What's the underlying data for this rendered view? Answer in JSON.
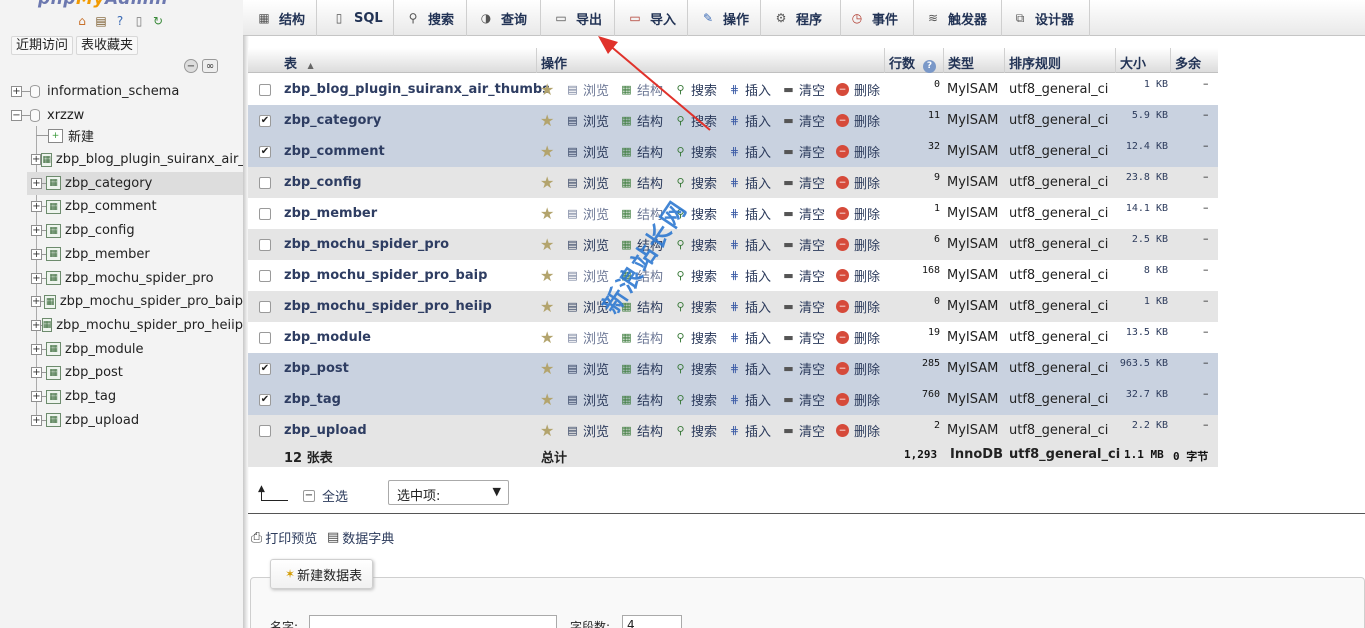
{
  "nav": {
    "logo_parts": [
      "php",
      "My",
      "Admin"
    ],
    "recent_btn": "近期访问",
    "favorites_btn": "表收藏夹",
    "databases": [
      {
        "name": "information_schema",
        "expanded": false
      },
      {
        "name": "xrzzw",
        "expanded": true
      }
    ],
    "new_label": "新建",
    "tables": [
      "zbp_blog_plugin_suiranx_air_",
      "zbp_category",
      "zbp_comment",
      "zbp_config",
      "zbp_member",
      "zbp_mochu_spider_pro",
      "zbp_mochu_spider_pro_baip",
      "zbp_mochu_spider_pro_heiip",
      "zbp_module",
      "zbp_post",
      "zbp_tag",
      "zbp_upload"
    ],
    "selected_table": "zbp_category"
  },
  "menu": {
    "tabs": [
      {
        "label": "结构",
        "icon": "structure-icon"
      },
      {
        "label": "SQL",
        "icon": "sql-icon"
      },
      {
        "label": "搜索",
        "icon": "search-icon"
      },
      {
        "label": "查询",
        "icon": "query-icon"
      },
      {
        "label": "导出",
        "icon": "export-icon"
      },
      {
        "label": "导入",
        "icon": "import-icon"
      },
      {
        "label": "操作",
        "icon": "wrench-icon"
      },
      {
        "label": "程序",
        "icon": "routines-icon"
      },
      {
        "label": "事件",
        "icon": "clock-icon"
      },
      {
        "label": "触发器",
        "icon": "trigger-icon"
      },
      {
        "label": "设计器",
        "icon": "designer-icon"
      }
    ]
  },
  "table": {
    "headers": {
      "table": "表",
      "sort_indicator": "▲",
      "action": "操作",
      "rows": "行数",
      "type": "类型",
      "collation": "排序规则",
      "size": "大小",
      "overhead": "多余"
    },
    "actions": {
      "browse": "浏览",
      "structure": "结构",
      "search": "搜索",
      "insert": "插入",
      "empty": "清空",
      "drop": "删除"
    },
    "rows": [
      {
        "name": "zbp_blog_plugin_suiranx_air_thumbs",
        "rows": "0",
        "type": "MyISAM",
        "collation": "utf8_general_ci",
        "size": "1 KB",
        "overhead": "–",
        "checked": false
      },
      {
        "name": "zbp_category",
        "rows": "11",
        "type": "MyISAM",
        "collation": "utf8_general_ci",
        "size": "5.9 KB",
        "overhead": "–",
        "checked": true
      },
      {
        "name": "zbp_comment",
        "rows": "32",
        "type": "MyISAM",
        "collation": "utf8_general_ci",
        "size": "12.4 KB",
        "overhead": "–",
        "checked": true
      },
      {
        "name": "zbp_config",
        "rows": "9",
        "type": "MyISAM",
        "collation": "utf8_general_ci",
        "size": "23.8 KB",
        "overhead": "–",
        "checked": false
      },
      {
        "name": "zbp_member",
        "rows": "1",
        "type": "MyISAM",
        "collation": "utf8_general_ci",
        "size": "14.1 KB",
        "overhead": "–",
        "checked": false
      },
      {
        "name": "zbp_mochu_spider_pro",
        "rows": "6",
        "type": "MyISAM",
        "collation": "utf8_general_ci",
        "size": "2.5 KB",
        "overhead": "–",
        "checked": false
      },
      {
        "name": "zbp_mochu_spider_pro_baip",
        "rows": "168",
        "type": "MyISAM",
        "collation": "utf8_general_ci",
        "size": "8 KB",
        "overhead": "–",
        "checked": false
      },
      {
        "name": "zbp_mochu_spider_pro_heiip",
        "rows": "0",
        "type": "MyISAM",
        "collation": "utf8_general_ci",
        "size": "1 KB",
        "overhead": "–",
        "checked": false
      },
      {
        "name": "zbp_module",
        "rows": "19",
        "type": "MyISAM",
        "collation": "utf8_general_ci",
        "size": "13.5 KB",
        "overhead": "–",
        "checked": false
      },
      {
        "name": "zbp_post",
        "rows": "285",
        "type": "MyISAM",
        "collation": "utf8_general_ci",
        "size": "963.5 KB",
        "overhead": "–",
        "checked": true
      },
      {
        "name": "zbp_tag",
        "rows": "760",
        "type": "MyISAM",
        "collation": "utf8_general_ci",
        "size": "32.7 KB",
        "overhead": "–",
        "checked": true
      },
      {
        "name": "zbp_upload",
        "rows": "2",
        "type": "MyISAM",
        "collation": "utf8_general_ci",
        "size": "2.2 KB",
        "overhead": "–",
        "checked": false
      }
    ],
    "footer": {
      "count": "12 张表",
      "total": "总计",
      "rows": "1,293",
      "engine": "InnoDB",
      "collation": "utf8_general_ci",
      "size": "1.1 MB",
      "overhead": "0 字节"
    }
  },
  "bulk": {
    "check_all": "全选",
    "with_selected": "选中项:"
  },
  "links": {
    "print": "打印预览",
    "dictionary": "数据字典"
  },
  "create": {
    "legend": "新建数据表",
    "name_label": "名字:",
    "fields_label": "字段数:",
    "fields_value": "4"
  },
  "watermark": "新浪站长网",
  "colors": {
    "accent": "#2e3d62",
    "marked_row": "#c9d2e0",
    "arrow": "#e0322b",
    "watermark": "#2f79d1"
  }
}
